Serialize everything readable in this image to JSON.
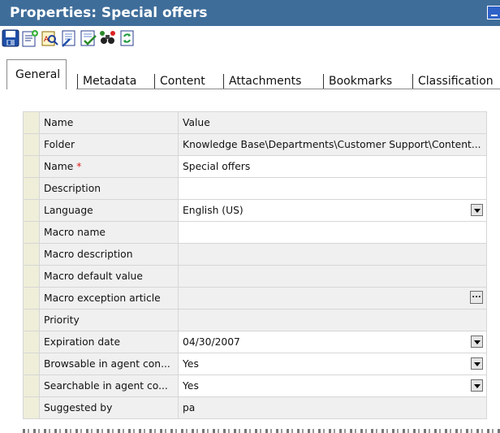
{
  "window": {
    "title": "Properties: Special offers"
  },
  "toolbar": {
    "tools": [
      "save-icon",
      "edit-note-icon",
      "find-replace-icon",
      "edit-document-icon",
      "check-spelling-icon",
      "binoculars-icon",
      "refresh-icon"
    ]
  },
  "tabs": [
    "General",
    "Metadata",
    "Content",
    "Attachments",
    "Bookmarks",
    "Classification"
  ],
  "grid": {
    "header": {
      "name": "Name",
      "value": "Value"
    },
    "rows": [
      {
        "name": "Folder",
        "value": "Knowledge Base\\Departments\\Customer Support\\Content..."
      },
      {
        "name": "Name",
        "required": "*",
        "value": "Special offers"
      },
      {
        "name": "Description",
        "value": ""
      },
      {
        "name": "Language",
        "value": "English (US)"
      },
      {
        "name": "Macro name",
        "value": ""
      },
      {
        "name": "Macro description",
        "value": ""
      },
      {
        "name": "Macro default value",
        "value": ""
      },
      {
        "name": "Macro exception article",
        "value": "",
        "button": "..."
      },
      {
        "name": "Priority",
        "value": ""
      },
      {
        "name": "Expiration date",
        "value": "04/30/2007"
      },
      {
        "name": "Browsable in agent con...",
        "value": "Yes"
      },
      {
        "name": "Searchable in agent co...",
        "value": "Yes"
      },
      {
        "name": "Suggested by",
        "value": "pa"
      }
    ]
  }
}
